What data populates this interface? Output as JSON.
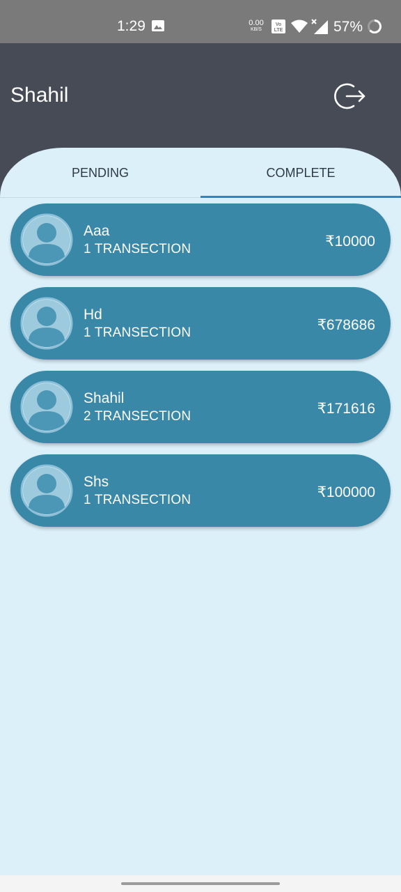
{
  "status_bar": {
    "time": "1:29",
    "net_speed": "0.00",
    "net_unit": "KB/S",
    "volte": "Vo LTE",
    "battery": "57%"
  },
  "header": {
    "title": "Shahil",
    "logout_icon": "logout-icon"
  },
  "tabs": {
    "pending": "PENDING",
    "complete": "COMPLETE",
    "active": "complete"
  },
  "colors": {
    "header_bg": "#474b56",
    "content_bg": "#dcf0fa",
    "card_bg": "#3988a8",
    "tab_indicator": "#2a86c8"
  },
  "customers": [
    {
      "name": "Aaa",
      "transactions": "1 TRANSECTION",
      "amount": "₹10000"
    },
    {
      "name": "Hd",
      "transactions": "1 TRANSECTION",
      "amount": "₹678686"
    },
    {
      "name": "Shahil",
      "transactions": "2 TRANSECTION",
      "amount": "₹171616"
    },
    {
      "name": "Shs",
      "transactions": "1 TRANSECTION",
      "amount": "₹100000"
    }
  ]
}
